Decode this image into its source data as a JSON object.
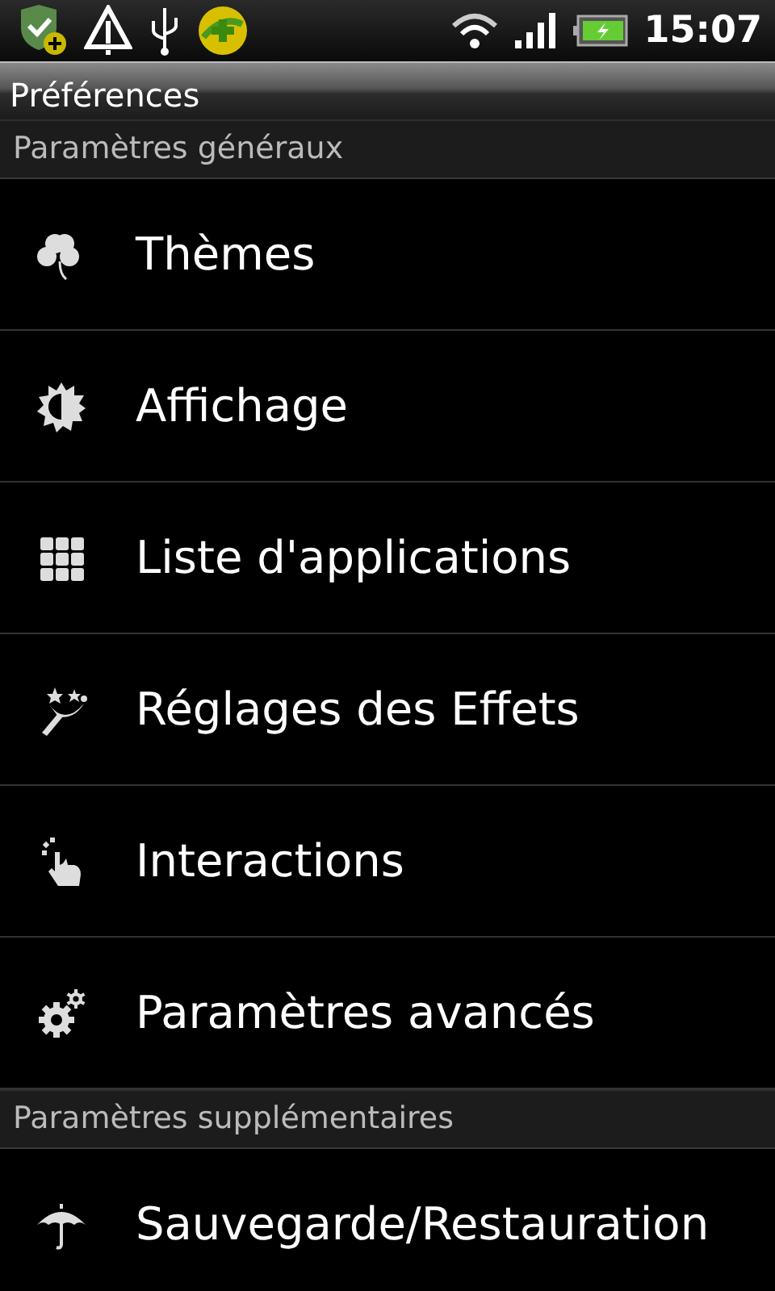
{
  "status_bar": {
    "time": "15:07"
  },
  "title_bar": {
    "title": "Préférences"
  },
  "sections": [
    {
      "header": "Paramètres généraux",
      "items": [
        {
          "label": "Thèmes",
          "kind": "clover"
        },
        {
          "label": "Affichage",
          "kind": "brightness"
        },
        {
          "label": "Liste d'applications",
          "kind": "grid"
        },
        {
          "label": "Réglages des Effets",
          "kind": "wand"
        },
        {
          "label": "Interactions",
          "kind": "hand"
        },
        {
          "label": "Paramètres avancés",
          "kind": "gears"
        }
      ]
    },
    {
      "header": "Paramètres supplémentaires",
      "items": [
        {
          "label": "Sauvegarde/Restauration",
          "kind": "umbrella"
        }
      ]
    }
  ]
}
